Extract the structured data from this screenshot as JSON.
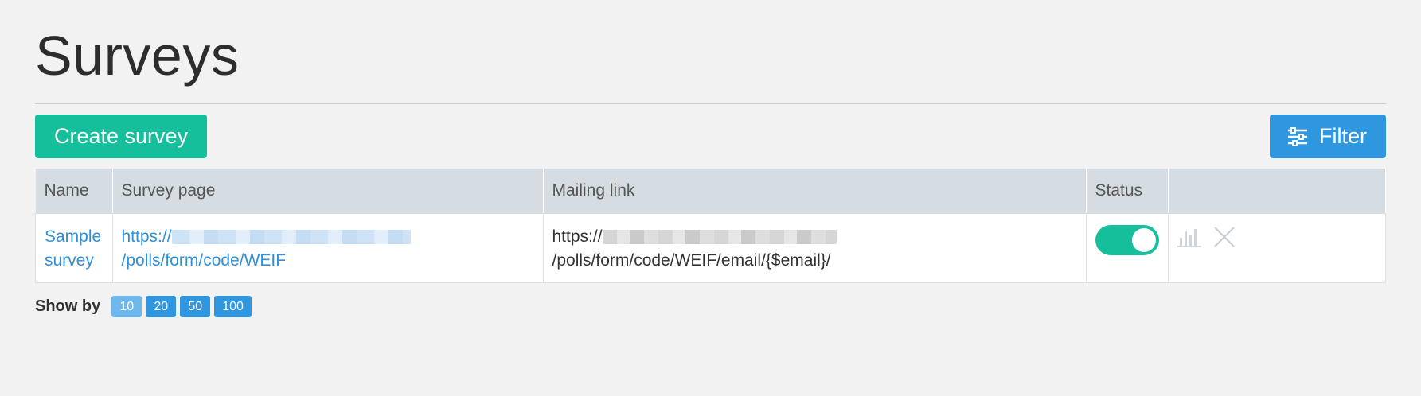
{
  "page": {
    "title": "Surveys"
  },
  "toolbar": {
    "create_label": "Create survey",
    "filter_label": "Filter"
  },
  "table": {
    "headers": {
      "name": "Name",
      "survey_page": "Survey page",
      "mailing_link": "Mailing link",
      "status": "Status"
    },
    "rows": [
      {
        "name": "Sample survey",
        "survey_page_prefix": "https://",
        "survey_page_suffix": "/polls/form/code/WEIF",
        "mailing_prefix": "https://",
        "mailing_suffix": "/polls/form/code/WEIF/email/{$email}/",
        "status_on": true
      }
    ]
  },
  "pagination": {
    "label": "Show by",
    "options": [
      "10",
      "20",
      "50",
      "100"
    ],
    "selected": "10"
  },
  "colors": {
    "accent_green": "#16bf9b",
    "accent_blue": "#2f97e0",
    "link": "#2f8fd8"
  }
}
